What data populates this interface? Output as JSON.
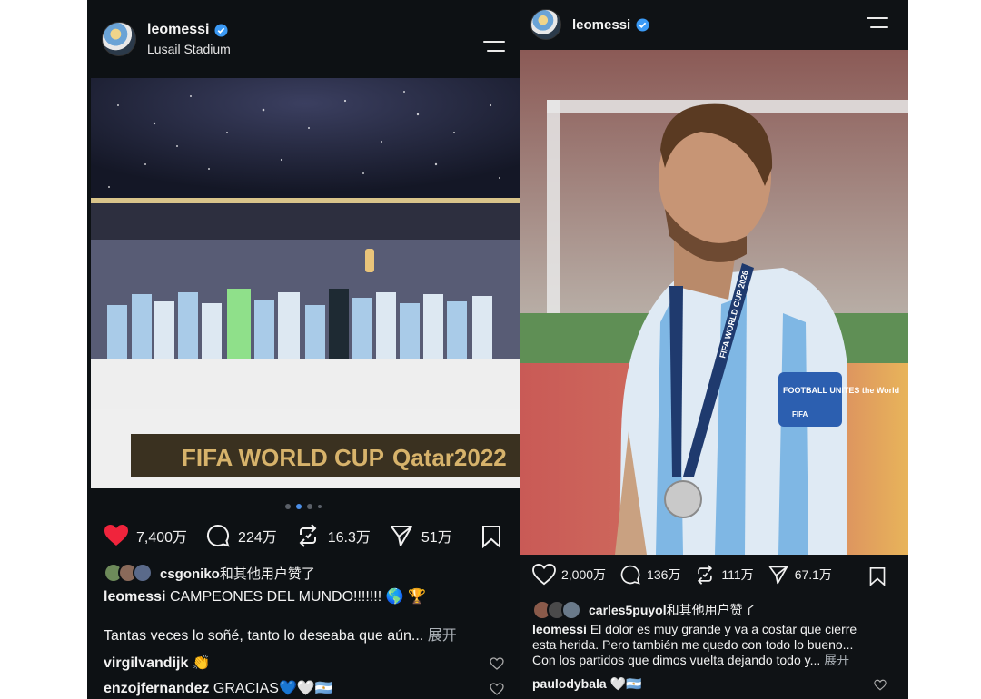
{
  "posts": {
    "left": {
      "username": "leomessi",
      "location": "Lusail Stadium",
      "banner_text": "FIFA WORLD CUP",
      "banner_text2": "Qatar2022",
      "likes": "7,400万",
      "comments": "224万",
      "reposts": "16.3万",
      "shares": "51万",
      "liked_by": "csgoniko",
      "liked_by_suffix": "和其他用户赞了",
      "caption_user": "leomessi",
      "caption": "CAMPEONES DEL MUNDO!!!!!!! 🌎 🏆",
      "caption_line2": "Tantas veces lo soñé, tanto lo deseaba que aún...",
      "more_label": "展开",
      "comment1_user": "virgilvandijk",
      "comment1_text": "👏",
      "comment2_user": "enzojfernandez",
      "comment2_text": "GRACIAS💙🤍🇦🇷",
      "colors": {
        "like": "#f0243c"
      }
    },
    "right": {
      "username": "leomessi",
      "likes": "2,000万",
      "comments": "136万",
      "reposts": "111万",
      "shares": "67.1万",
      "liked_by": "carles5puyol",
      "liked_by_suffix": "和其他用户赞了",
      "caption_user": "leomessi",
      "caption_line1": "El dolor es muy grande y va a costar que cierre",
      "caption_line2": "esta herida. Pero también me quedo con todo lo bueno...",
      "caption_line3": "Con los partidos que dimos vuelta dejando todo y...",
      "more_label": "展开",
      "comment1_user": "paulodybala",
      "comment1_text": "🤍🇦🇷",
      "medal_text": "FIFA WORLD CUP 2026",
      "armband_text": "FOOTBALL UNITES the World",
      "armband_sub": "FIFA"
    }
  }
}
